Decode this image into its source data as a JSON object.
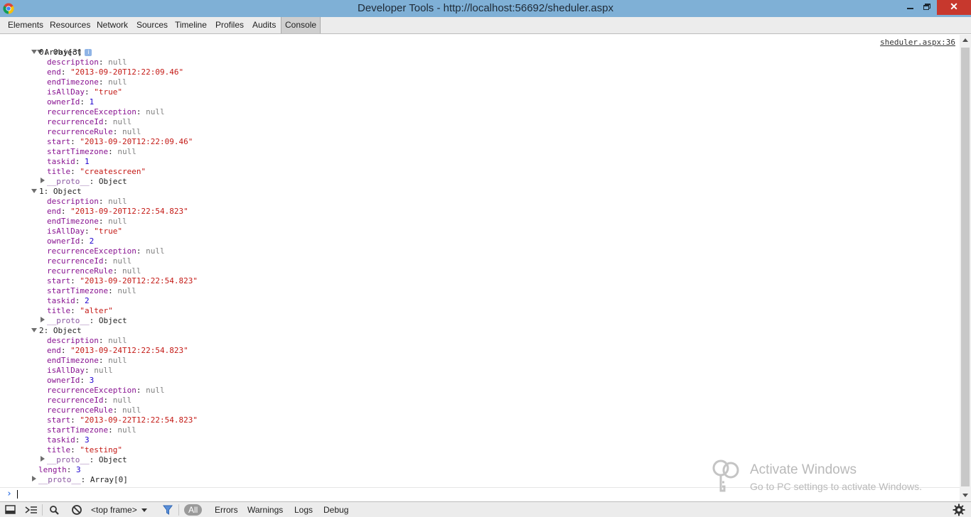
{
  "window": {
    "title": "Developer Tools - http://localhost:56692/sheduler.aspx",
    "app_icon": "chrome-icon",
    "controls": [
      "minimize-icon",
      "restore-icon",
      "close-icon"
    ],
    "close_glyph": "✕"
  },
  "tabs": [
    {
      "label": "Elements"
    },
    {
      "label": "Resources"
    },
    {
      "label": "Network"
    },
    {
      "label": "Sources"
    },
    {
      "label": "Timeline"
    },
    {
      "label": "Profiles"
    },
    {
      "label": "Audits"
    },
    {
      "label": "Console",
      "selected": true
    }
  ],
  "console": {
    "source_link": "sheduler.aspx:36",
    "array_label": "Array[3]",
    "info_badge": "i",
    "objects": [
      {
        "label": "0: Object",
        "fields": [
          {
            "key": "description",
            "value": "null",
            "type": "null"
          },
          {
            "key": "end",
            "value": "\"2013-09-20T12:22:09.46\"",
            "type": "str"
          },
          {
            "key": "endTimezone",
            "value": "null",
            "type": "null"
          },
          {
            "key": "isAllDay",
            "value": "\"true\"",
            "type": "str"
          },
          {
            "key": "ownerId",
            "value": "1",
            "type": "num"
          },
          {
            "key": "recurrenceException",
            "value": "null",
            "type": "null"
          },
          {
            "key": "recurrenceId",
            "value": "null",
            "type": "null"
          },
          {
            "key": "recurrenceRule",
            "value": "null",
            "type": "null"
          },
          {
            "key": "start",
            "value": "\"2013-09-20T12:22:09.46\"",
            "type": "str"
          },
          {
            "key": "startTimezone",
            "value": "null",
            "type": "null"
          },
          {
            "key": "taskid",
            "value": "1",
            "type": "num"
          },
          {
            "key": "title",
            "value": "\"createscreen\"",
            "type": "str"
          }
        ],
        "proto": {
          "key": "__proto__",
          "value": "Object"
        }
      },
      {
        "label": "1: Object",
        "fields": [
          {
            "key": "description",
            "value": "null",
            "type": "null"
          },
          {
            "key": "end",
            "value": "\"2013-09-20T12:22:54.823\"",
            "type": "str"
          },
          {
            "key": "endTimezone",
            "value": "null",
            "type": "null"
          },
          {
            "key": "isAllDay",
            "value": "\"true\"",
            "type": "str"
          },
          {
            "key": "ownerId",
            "value": "2",
            "type": "num"
          },
          {
            "key": "recurrenceException",
            "value": "null",
            "type": "null"
          },
          {
            "key": "recurrenceId",
            "value": "null",
            "type": "null"
          },
          {
            "key": "recurrenceRule",
            "value": "null",
            "type": "null"
          },
          {
            "key": "start",
            "value": "\"2013-09-20T12:22:54.823\"",
            "type": "str"
          },
          {
            "key": "startTimezone",
            "value": "null",
            "type": "null"
          },
          {
            "key": "taskid",
            "value": "2",
            "type": "num"
          },
          {
            "key": "title",
            "value": "\"alter\"",
            "type": "str"
          }
        ],
        "proto": {
          "key": "__proto__",
          "value": "Object"
        }
      },
      {
        "label": "2: Object",
        "fields": [
          {
            "key": "description",
            "value": "null",
            "type": "null"
          },
          {
            "key": "end",
            "value": "\"2013-09-24T12:22:54.823\"",
            "type": "str"
          },
          {
            "key": "endTimezone",
            "value": "null",
            "type": "null"
          },
          {
            "key": "isAllDay",
            "value": "null",
            "type": "null"
          },
          {
            "key": "ownerId",
            "value": "3",
            "type": "num"
          },
          {
            "key": "recurrenceException",
            "value": "null",
            "type": "null"
          },
          {
            "key": "recurrenceId",
            "value": "null",
            "type": "null"
          },
          {
            "key": "recurrenceRule",
            "value": "null",
            "type": "null"
          },
          {
            "key": "start",
            "value": "\"2013-09-22T12:22:54.823\"",
            "type": "str"
          },
          {
            "key": "startTimezone",
            "value": "null",
            "type": "null"
          },
          {
            "key": "taskid",
            "value": "3",
            "type": "num"
          },
          {
            "key": "title",
            "value": "\"testing\"",
            "type": "str"
          }
        ],
        "proto": {
          "key": "__proto__",
          "value": "Object"
        }
      }
    ],
    "length": {
      "key": "length",
      "value": "3"
    },
    "array_proto": {
      "key": "__proto__",
      "value": "Array[0]"
    },
    "prompt_glyph": "›"
  },
  "watermark": {
    "title": "Activate Windows",
    "subtitle": "Go to PC settings to activate Windows.",
    "icon": "key-icon"
  },
  "statusbar": {
    "icons": [
      "dock-icon",
      "show-drawer-icon",
      "search-icon",
      "clear-console-icon",
      "filter-icon",
      "settings-gear-icon"
    ],
    "frame_select": "<top frame>",
    "filters": [
      {
        "label": "All",
        "active": true
      },
      {
        "label": "Errors"
      },
      {
        "label": "Warnings"
      },
      {
        "label": "Logs"
      },
      {
        "label": "Debug"
      }
    ]
  },
  "colors": {
    "titlebar": "#7fb0d6",
    "close_button": "#c7382d",
    "property_key": "#881391",
    "string_value": "#c41a16",
    "number_value": "#1c00cf",
    "null_value": "#808080",
    "prompt": "#3b78e7"
  }
}
